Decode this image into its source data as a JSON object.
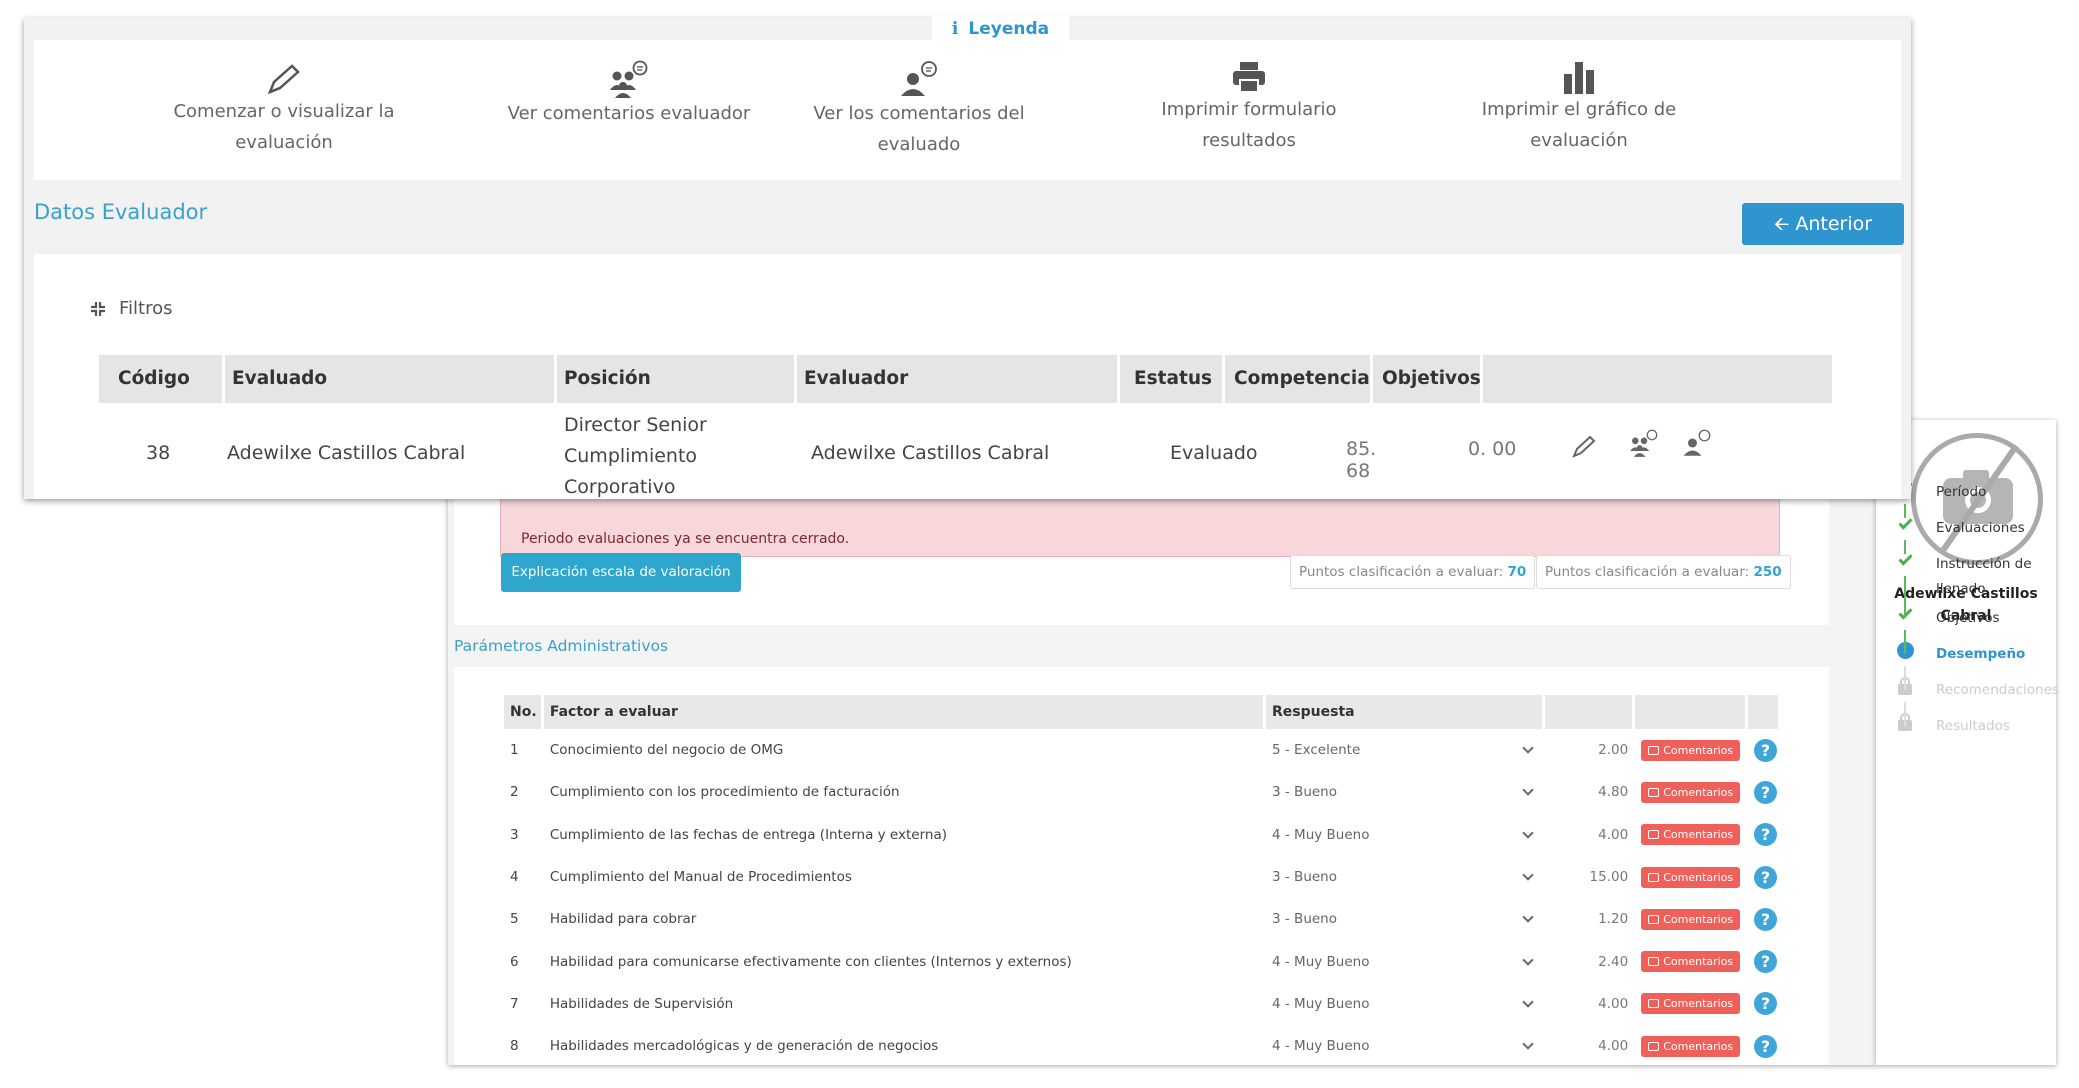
{
  "legend": {
    "title": "Leyenda",
    "items": [
      {
        "line1": "Comenzar o visualizar la",
        "line2": "evaluación",
        "icon": "pencil-icon"
      },
      {
        "line1": "Ver comentarios evaluador",
        "line2": "",
        "icon": "group-comment-icon"
      },
      {
        "line1": "Ver los comentarios del",
        "line2": "evaluado",
        "icon": "user-comment-icon"
      },
      {
        "line1": "Imprimir formulario",
        "line2": "resultados",
        "icon": "printer-icon"
      },
      {
        "line1": "Imprimir el gráfico de",
        "line2": "evaluación",
        "icon": "bar-chart-icon"
      }
    ]
  },
  "datos": {
    "title": "Datos Evaluador",
    "back_button": "Anterior",
    "filters_label": "Filtros",
    "headers": [
      "Código",
      "Evaluado",
      "Posición",
      "Evaluador",
      "Estatus",
      "Competencia",
      "Objetivos"
    ],
    "row": {
      "codigo": "38",
      "evaluado": "Adewilxe Castillos Cabral",
      "posicion_1": "Director Senior",
      "posicion_2": "Cumplimiento",
      "posicion_3": "Corporativo",
      "evaluador": "Adewilxe Castillos Cabral",
      "estatus": "Evaluado",
      "competencia": "85. 68",
      "objetivos": "0. 00"
    }
  },
  "form": {
    "alert": "Periodo evaluaciones ya se encuentra cerrado.",
    "explain_button": "Explicación escala de valoración",
    "points_label_1": "Puntos clasificación a evaluar:",
    "points_value_1": "70",
    "points_label_2": "Puntos clasificación a evaluar:",
    "points_value_2": "250",
    "section_title": "Parámetros Administrativos",
    "headers": {
      "no": "No.",
      "factor": "Factor a evaluar",
      "respuesta": "Respuesta"
    },
    "comment_label": "Comentarios",
    "help": "?",
    "rows": [
      {
        "no": "1",
        "factor": "Conocimiento del negocio de OMG",
        "respuesta": "5 - Excelente",
        "valor": "2.00"
      },
      {
        "no": "2",
        "factor": "Cumplimiento con los procedimiento de facturación",
        "respuesta": "3 - Bueno",
        "valor": "4.80"
      },
      {
        "no": "3",
        "factor": "Cumplimiento de las fechas de entrega (Interna y externa)",
        "respuesta": "4 - Muy Bueno",
        "valor": "4.00"
      },
      {
        "no": "4",
        "factor": "Cumplimiento del Manual de Procedimientos",
        "respuesta": "3 - Bueno",
        "valor": "15.00"
      },
      {
        "no": "5",
        "factor": "Habilidad para cobrar",
        "respuesta": "3 - Bueno",
        "valor": "1.20"
      },
      {
        "no": "6",
        "factor": "Habilidad para comunicarse efectivamente con clientes (Internos y externos)",
        "respuesta": "4 - Muy Bueno",
        "valor": "2.40"
      },
      {
        "no": "7",
        "factor": "Habilidades de Supervisión",
        "respuesta": "4 - Muy Bueno",
        "valor": "4.00"
      },
      {
        "no": "8",
        "factor": "Habilidades mercadológicas y de generación de negocios",
        "respuesta": "4 - Muy Bueno",
        "valor": "4.00"
      }
    ]
  },
  "sidebar": {
    "user_name_1": "Adewilxe Castillos",
    "user_name_2": "Cabral",
    "steps": [
      {
        "label": "Período",
        "state": "done"
      },
      {
        "label": "Evaluaciones",
        "state": "done"
      },
      {
        "label": "Instrucción de llenado",
        "state": "done"
      },
      {
        "label": "Objetivos",
        "state": "done"
      },
      {
        "label": "Desempeño",
        "state": "current"
      },
      {
        "label": "Recomendaciones",
        "state": "locked"
      },
      {
        "label": "Resultados",
        "state": "locked"
      }
    ]
  },
  "colors": {
    "accent": "#2e95cf",
    "comment_button": "#f0605a",
    "alert_bg": "#f8d7da",
    "step_done": "#4cae4c"
  }
}
